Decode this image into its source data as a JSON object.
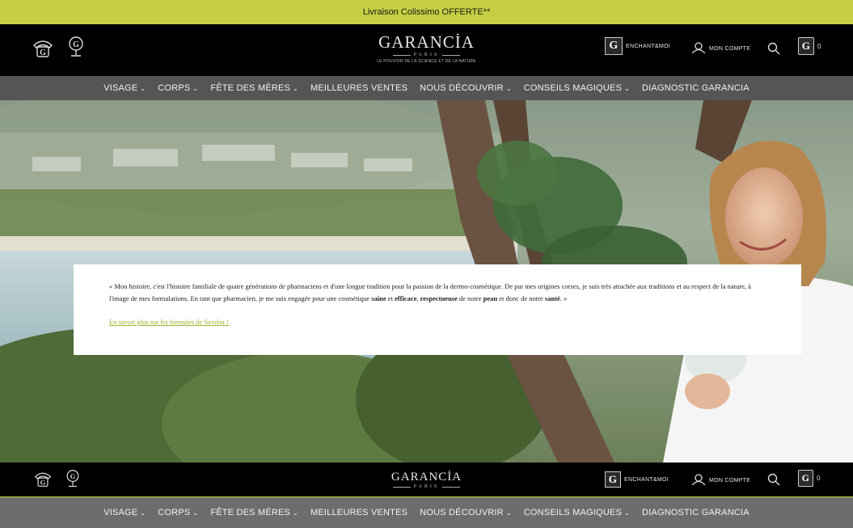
{
  "promo": {
    "text": "Livraison Colissimo OFFERTE**"
  },
  "header": {
    "logo_main": "GARANCİA",
    "logo_sub": "PARIS",
    "logo_tagline": "LE POUVOIR DE LA SCIENCE ET DE LA NATURE",
    "enchant_label": "ENCHANT&MOI",
    "account_label": "MON COMPTE",
    "cart_count": "0",
    "g_letter": "G"
  },
  "nav": {
    "items": [
      {
        "label": "VISAGE",
        "dropdown": true
      },
      {
        "label": "CORPS",
        "dropdown": true
      },
      {
        "label": "FÊTE DES MÈRES",
        "dropdown": true
      },
      {
        "label": "MEILLEURES VENTES",
        "dropdown": false
      },
      {
        "label": "NOUS DÉCOUVRIR",
        "dropdown": true
      },
      {
        "label": "CONSEILS MAGIQUES",
        "dropdown": true
      },
      {
        "label": "DIAGNOSTIC GARANCIA",
        "dropdown": false
      }
    ],
    "caret": "⌄"
  },
  "quote": {
    "p1": "« Mon histoire, c'est l'histoire familiale de quatre générations de pharmaciens et d'une longue tradition pour la passion de la dermo-cosmétique. De par mes origines corses, je suis très attachée aux traditions et au respect de la nature, à l'image de mes formulations. En tant que pharmacien, je me suis engagée pour une cosmétique ",
    "b1": "saine",
    "t2": " et ",
    "b2": "efficace",
    "t3": ", ",
    "b3": "respectueuse",
    "t4": " de notre ",
    "b4": "peau",
    "t5": " et donc de notre ",
    "b5": "santé",
    "t6": ". »",
    "link": "En savoir plus sur les formules de Savéria !"
  },
  "colors": {
    "accent": "#c6cf42",
    "header_bg": "#000000",
    "nav_bg": "#464646"
  },
  "icons": [
    "phone-g-icon",
    "location-pin-icon",
    "g-logo-box-icon",
    "user-icon",
    "search-icon",
    "cart-bag-icon"
  ]
}
